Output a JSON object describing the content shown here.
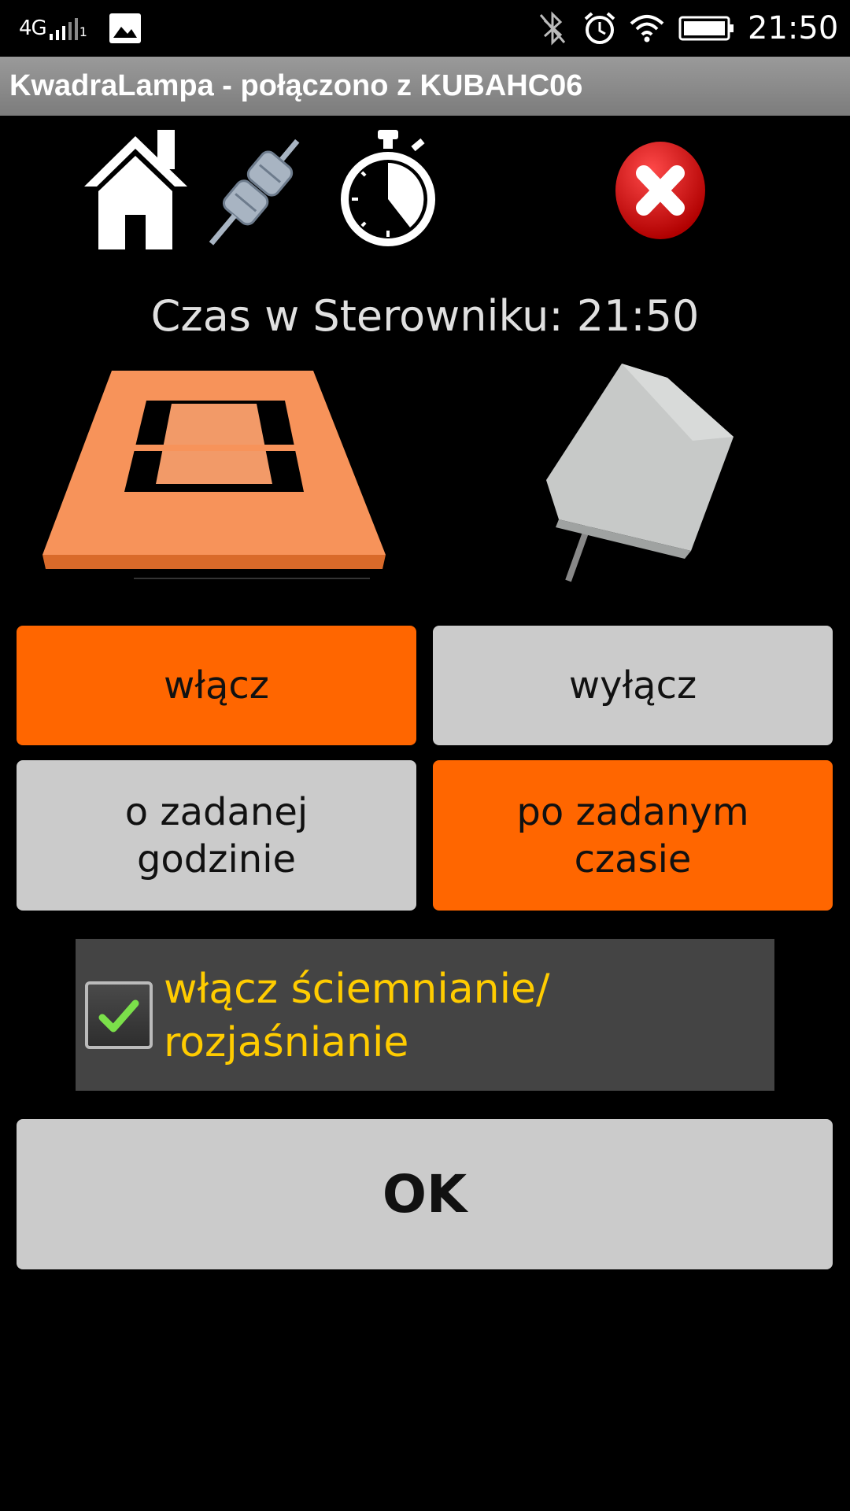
{
  "status_bar": {
    "network": "4G",
    "sim": "1",
    "time": "21:50",
    "icons": [
      "gallery-icon",
      "bluetooth-icon",
      "alarm-icon",
      "wifi-icon",
      "battery-icon"
    ]
  },
  "title_bar": {
    "title": "KwadraLampa - połączono z KUBAHC06"
  },
  "toolbar": {
    "icons": [
      "home-icon",
      "plug-icon",
      "timer-icon",
      "close-icon"
    ]
  },
  "clock": {
    "label": "Czas w Sterowniku:  21:50"
  },
  "buttons": {
    "on": "włącz",
    "off": "wyłącz",
    "at_time": "o zadanej godzinie",
    "after_time": "po zadanym czasie",
    "ok": "OK"
  },
  "dimming": {
    "label": " włącz ściemnianie/ rozjaśnianie",
    "checked": true
  },
  "colors": {
    "accent": "#ff6600",
    "inactive": "#cbcbcb",
    "checkbox_label": "#ffcc00"
  }
}
